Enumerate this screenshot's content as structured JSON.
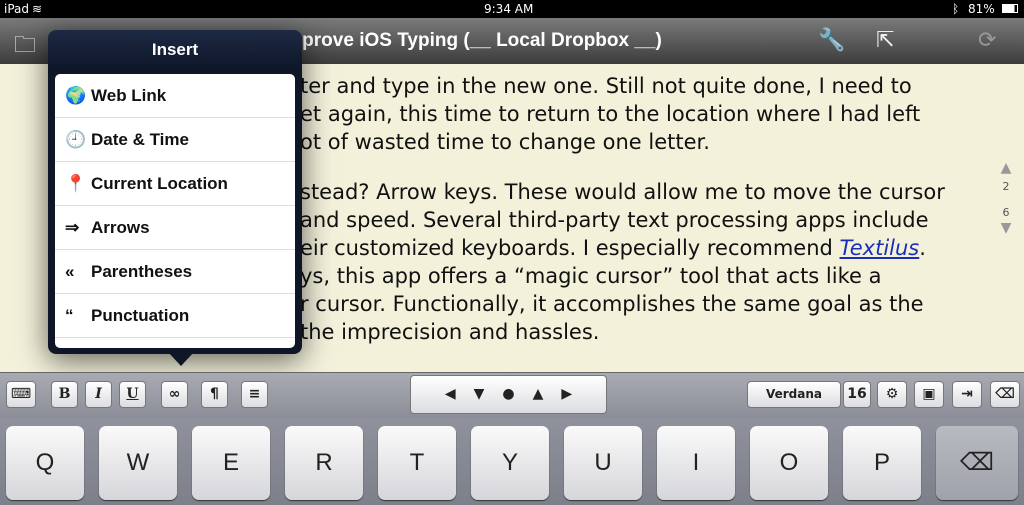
{
  "status": {
    "device": "iPad",
    "time": "9:34 AM",
    "battery": "81%"
  },
  "nav": {
    "title": "Improve iOS Typing (__ Local Dropbox __)",
    "icons": [
      "folder-icon",
      "wrench-icon",
      "share-icon",
      "sync-icon"
    ]
  },
  "doc": {
    "lines": [
      "ter and type in the new one. Still not quite done, I need to",
      "et again, this time to return to the location where I had left",
      "ot of wasted time to change one letter.",
      "stead? Arrow keys. These would allow me to move the cursor",
      "and speed. Several third-party text processing apps include",
      "eir customized keyboards. I especially recommend ",
      "ys, this app offers a “magic cursor” tool that acts like a",
      "r cursor. Functionally, it accomplishes the same goal as the",
      "the imprecision and hassles."
    ],
    "link": "Textilus",
    "after_link": ".",
    "page_current": "2",
    "page_total": "6"
  },
  "popover": {
    "title": "Insert",
    "items": [
      {
        "glyph": "🌍",
        "label": "Web Link"
      },
      {
        "glyph": "🕘",
        "label": "Date & Time"
      },
      {
        "glyph": "📍",
        "label": "Current Location"
      },
      {
        "glyph": "⇒",
        "label": "Arrows"
      },
      {
        "glyph": "«",
        "label": "Parentheses"
      },
      {
        "glyph": "“",
        "label": "Punctuation"
      }
    ]
  },
  "toolbar": {
    "bold": "B",
    "italic": "I",
    "underline": "U",
    "link": "∞",
    "para": "¶",
    "font": "Verdana",
    "size": "16"
  },
  "keys": [
    "Q",
    "W",
    "E",
    "R",
    "T",
    "Y",
    "U",
    "I",
    "O",
    "P"
  ]
}
